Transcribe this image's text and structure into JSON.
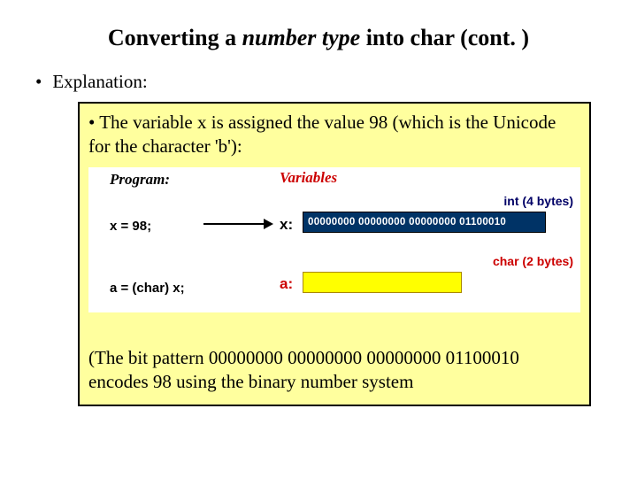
{
  "title": {
    "pre": "Converting a ",
    "em": "number type",
    "post": " into char (cont. )"
  },
  "bullet": {
    "dot": "•",
    "text": "Explanation:"
  },
  "panel": {
    "line1": "• The variable x is assigned the value 98 (which is the Unicode for the character 'b'):",
    "diagram": {
      "program_header": "Program:",
      "variables_header": "Variables",
      "int_label": "int (4 bytes)",
      "char_label": "char (2 bytes)",
      "stmt_x": "x = 98;",
      "stmt_a": "a = (char) x;",
      "x_name": "x:",
      "a_name": "a:",
      "x_bits": "00000000 00000000 00000000 01100010"
    },
    "note": "(The bit pattern 00000000 00000000 00000000 01100010 encodes 98 using the binary number system"
  }
}
